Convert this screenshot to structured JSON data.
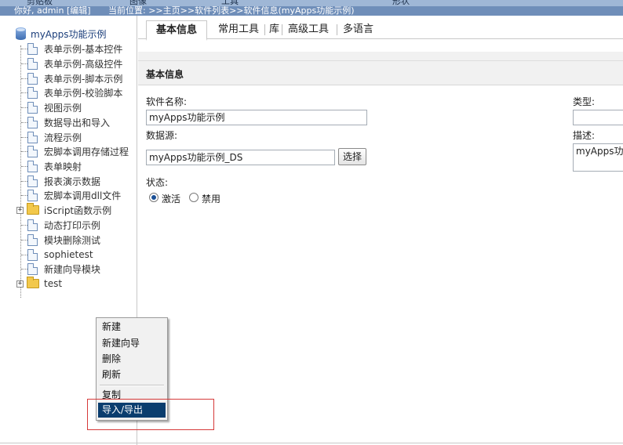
{
  "header": {
    "greeting": "你好, admin [编辑]",
    "location": "当前位置: >>主页>>软件列表>>软件信息(myApps功能示例)",
    "menu_clipped": [
      "剪贴板",
      "图像",
      "工具",
      "形状"
    ]
  },
  "sidebar": {
    "root": "myApps功能示例",
    "items": [
      {
        "label": "表单示例-基本控件",
        "type": "doc"
      },
      {
        "label": "表单示例-高级控件",
        "type": "doc"
      },
      {
        "label": "表单示例-脚本示例",
        "type": "doc"
      },
      {
        "label": "表单示例-校验脚本",
        "type": "doc"
      },
      {
        "label": "视图示例",
        "type": "doc"
      },
      {
        "label": "数据导出和导入",
        "type": "doc"
      },
      {
        "label": "流程示例",
        "type": "doc"
      },
      {
        "label": "宏脚本调用存储过程",
        "type": "doc"
      },
      {
        "label": "表单映射",
        "type": "doc"
      },
      {
        "label": "报表演示数据",
        "type": "doc"
      },
      {
        "label": "宏脚本调用dll文件",
        "type": "doc"
      },
      {
        "label": "iScript函数示例",
        "type": "folder"
      },
      {
        "label": "动态打印示例",
        "type": "doc"
      },
      {
        "label": "模块删除测试",
        "type": "doc"
      },
      {
        "label": "sophietest",
        "type": "doc"
      },
      {
        "label": "新建向导模块",
        "type": "doc"
      },
      {
        "label": "test",
        "type": "folder"
      }
    ]
  },
  "tabs": [
    "基本信息",
    "常用工具",
    "库",
    "高级工具",
    "多语言"
  ],
  "main": {
    "section_title": "基本信息",
    "software_name_label": "软件名称:",
    "software_name_value": "myApps功能示例",
    "datasource_label": "数据源:",
    "datasource_value": "myApps功能示例_DS",
    "select_button": "选择",
    "status_label": "状态:",
    "status_active": "激活",
    "status_disabled": "禁用",
    "type_label": "类型:",
    "description_label": "描述:",
    "description_value": "myApps功能示例"
  },
  "context_menu": {
    "items": [
      "新建",
      "新建向导",
      "删除",
      "刷新",
      "复制",
      "导入/导出"
    ]
  },
  "colors": {
    "menu_highlight": "#0a3d6e",
    "annotation_box": "#d63a3a"
  }
}
